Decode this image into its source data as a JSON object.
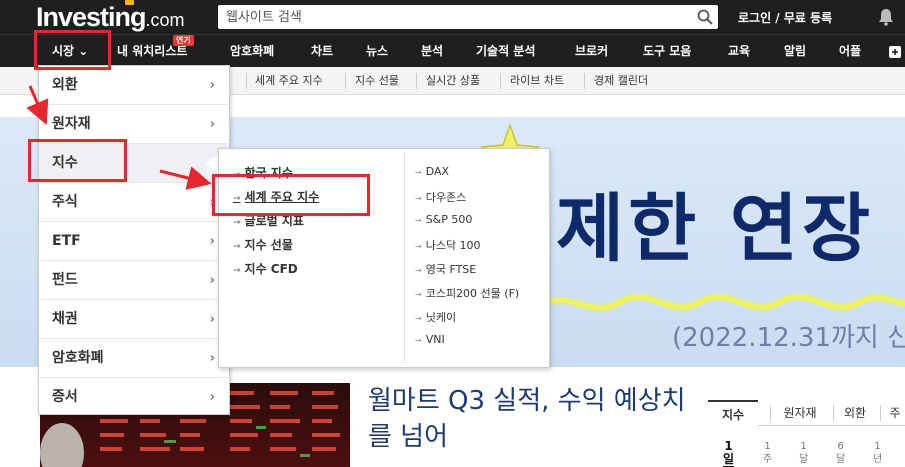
{
  "header": {
    "logo_text": "Investing",
    "logo_suffix": ".com",
    "search_placeholder": "웹사이트 검색",
    "login": "로그인 / 무료 등록",
    "accent_color": "#ffb300"
  },
  "mainnav": {
    "items": [
      "시장 ⌄",
      "내 워치리스트",
      "암호화폐",
      "차트",
      "뉴스",
      "분석",
      "기술적 분석",
      "브로커",
      "도구 모음",
      "교육",
      "알림",
      "어플"
    ],
    "badge": "연기"
  },
  "subnav": {
    "items": [
      "",
      "세계 주요 지수",
      "지수 선물",
      "실시간 상품",
      "라이브 차트",
      "경제 캘린더"
    ]
  },
  "dropdown": {
    "items": [
      "외환",
      "원자재",
      "지수",
      "주식",
      "ETF",
      "펀드",
      "채권",
      "암호화폐",
      "증서"
    ],
    "active_index": 2
  },
  "flyout": {
    "left": [
      "한국 지수",
      "세계 주요 지수",
      "글로벌 지표",
      "지수 선물",
      "지수 CFD"
    ],
    "right": [
      "DAX",
      "다우존스",
      "S&P 500",
      "나스닥 100",
      "영국 FTSE",
      "코스피200 선물 (F)",
      "닛케이",
      "VNI"
    ]
  },
  "banner": {
    "title": "제한 연장",
    "subtitle": "(2022.12.31까지 신"
  },
  "article": {
    "headline": "월마트 Q3 실적, 수익 예상치를 넘어"
  },
  "market_tabs": {
    "tabs": [
      "지수",
      "원자재",
      "외환",
      "주"
    ],
    "periods": [
      {
        "top": "1",
        "bottom": "일"
      },
      {
        "top": "1",
        "bottom": "주"
      },
      {
        "top": "1",
        "bottom": "달"
      },
      {
        "top": "6",
        "bottom": "달"
      },
      {
        "top": "1",
        "bottom": "년"
      }
    ]
  },
  "colors": {
    "annotation": "#e8262d",
    "nav_bg": "#1f1f1f",
    "banner_title": "#0e2a6b"
  }
}
